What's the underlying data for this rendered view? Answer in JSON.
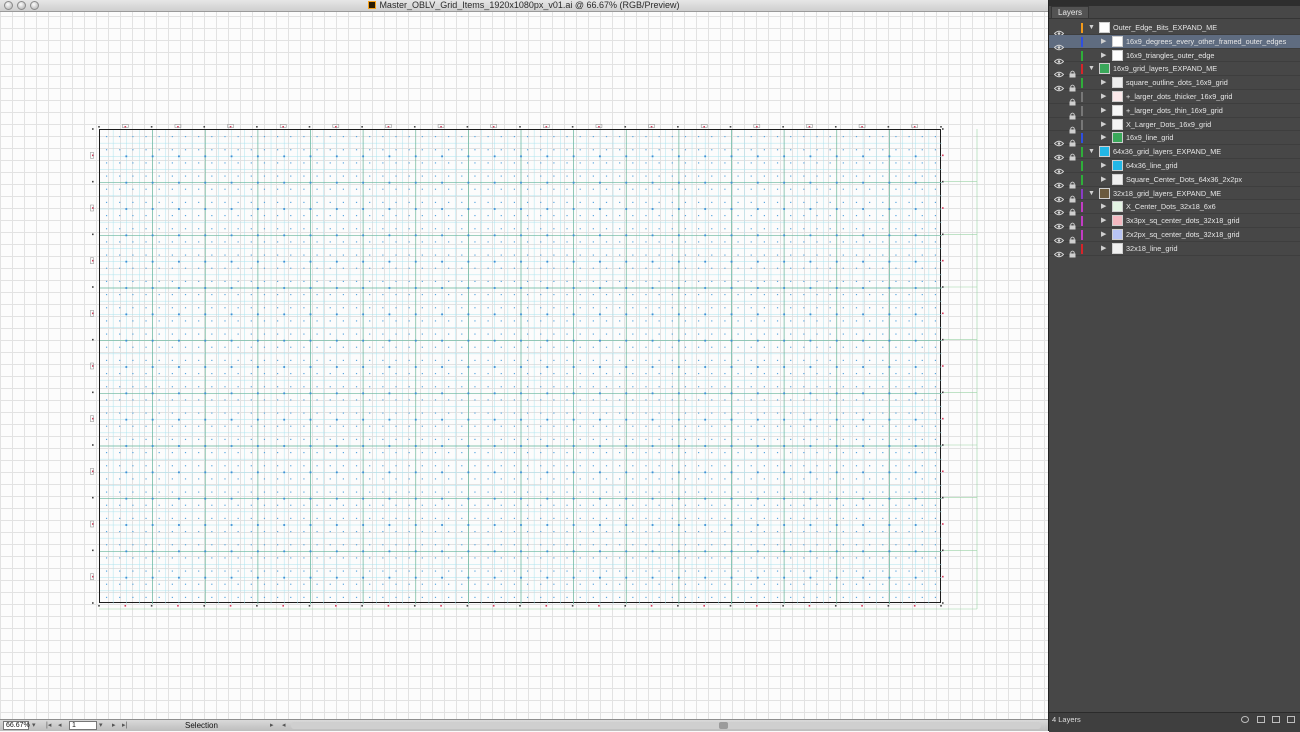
{
  "window": {
    "title": "Master_OBLV_Grid_Items_1920x1080px_v01.ai @ 66.67% (RGB/Preview)",
    "buttons": [
      "close",
      "minimize",
      "zoom"
    ]
  },
  "statusbar": {
    "zoom": "66.67%",
    "page": "1",
    "tool": "Selection"
  },
  "layers_panel": {
    "tab": "Layers",
    "count_label": "4 Layers",
    "layers": [
      {
        "name": "Outer_Edge_Bits_EXPAND_ME",
        "level": 0,
        "expanded": true,
        "visible": true,
        "locked": false,
        "color": "#f39a1a",
        "thumb": "#ffffff"
      },
      {
        "name": "16x9_degrees_every_other_framed_outer_edges",
        "level": 1,
        "expanded": false,
        "visible": true,
        "locked": false,
        "color": "#2f4fe0",
        "thumb": "#ffffff",
        "selected": true
      },
      {
        "name": "16x9_triangles_outer_edge",
        "level": 1,
        "expanded": false,
        "visible": true,
        "locked": false,
        "color": "#2fae3a",
        "thumb": "#ffffff"
      },
      {
        "name": "16x9_grid_layers_EXPAND_ME",
        "level": 0,
        "expanded": true,
        "visible": true,
        "locked": true,
        "color": "#d6242a",
        "thumb": "#3aa85a"
      },
      {
        "name": "square_outline_dots_16x9_grid",
        "level": 1,
        "expanded": false,
        "visible": true,
        "locked": true,
        "color": "#2fae3a",
        "thumb": "#eeeeee"
      },
      {
        "name": "+_larger_dots_thicker_16x9_grid",
        "level": 1,
        "expanded": false,
        "visible": false,
        "locked": true,
        "color": "#777777",
        "thumb": "#fbe9ea"
      },
      {
        "name": "+_larger_dots_thin_16x9_grid",
        "level": 1,
        "expanded": false,
        "visible": false,
        "locked": true,
        "color": "#777777",
        "thumb": "#f7f7f7"
      },
      {
        "name": "X_Larger_Dots_16x9_grid",
        "level": 1,
        "expanded": false,
        "visible": false,
        "locked": true,
        "color": "#777777",
        "thumb": "#f4f4f4"
      },
      {
        "name": "16x9_line_grid",
        "level": 1,
        "expanded": false,
        "visible": true,
        "locked": true,
        "color": "#2f4fe0",
        "thumb": "#3aa85a"
      },
      {
        "name": "64x36_grid_layers_EXPAND_ME",
        "level": 0,
        "expanded": true,
        "visible": true,
        "locked": true,
        "color": "#2fae3a",
        "thumb": "#22b7e6"
      },
      {
        "name": "64x36_line_grid",
        "level": 1,
        "expanded": false,
        "visible": true,
        "locked": false,
        "color": "#2fae3a",
        "thumb": "#22b7e6"
      },
      {
        "name": "Square_Center_Dots_64x36_2x2px",
        "level": 1,
        "expanded": false,
        "visible": true,
        "locked": true,
        "color": "#2fae3a",
        "thumb": "#f0f0f0"
      },
      {
        "name": "32x18_grid_layers_EXPAND_ME",
        "level": 0,
        "expanded": true,
        "visible": true,
        "locked": true,
        "color": "#8a3cc4",
        "thumb": "#6b5a3e"
      },
      {
        "name": "X_Center_Dots_32x18_6x6",
        "level": 1,
        "expanded": false,
        "visible": true,
        "locked": true,
        "color": "#c23cc4",
        "thumb": "#e4f4e4"
      },
      {
        "name": "3x3px_sq_center_dots_32x18_grid",
        "level": 1,
        "expanded": false,
        "visible": true,
        "locked": true,
        "color": "#c23cc4",
        "thumb": "#f4b8c0"
      },
      {
        "name": "2x2px_sq_center_dots_32x18_grid",
        "level": 1,
        "expanded": false,
        "visible": true,
        "locked": true,
        "color": "#c23cc4",
        "thumb": "#b8c4f4"
      },
      {
        "name": "32x18_line_grid",
        "level": 1,
        "expanded": false,
        "visible": true,
        "locked": true,
        "color": "#d6242a",
        "thumb": "#f0f0f0"
      }
    ]
  }
}
